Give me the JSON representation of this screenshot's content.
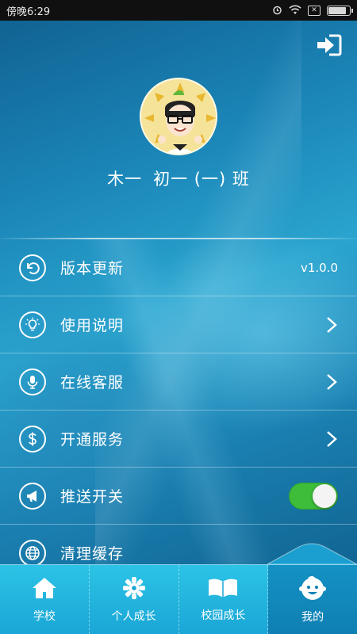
{
  "status_bar": {
    "time": "傍晚6:29",
    "battery_level": 0.9
  },
  "header": {
    "logout_icon": "logout-icon"
  },
  "profile": {
    "name": "木一",
    "class": "初一 (一) 班"
  },
  "menu": [
    {
      "label": "版本更新",
      "icon": "refresh-icon",
      "value": "v1.0.0"
    },
    {
      "label": "使用说明",
      "icon": "lightbulb-icon"
    },
    {
      "label": "在线客服",
      "icon": "microphone-icon"
    },
    {
      "label": "开通服务",
      "icon": "dollar-icon"
    },
    {
      "label": "推送开关",
      "icon": "megaphone-icon",
      "toggle_on": true
    },
    {
      "label": "清理缓存",
      "icon": "globe-icon"
    }
  ],
  "tabs": [
    {
      "label": "学校",
      "icon": "home-icon"
    },
    {
      "label": "个人成长",
      "icon": "gear-flower-icon"
    },
    {
      "label": "校园成长",
      "icon": "open-book-icon"
    },
    {
      "label": "我的",
      "icon": "baby-face-icon",
      "active": true
    }
  ],
  "colors": {
    "toggle_on": "#3dbd3a",
    "tab_bar": "#1aa6d6",
    "tab_active": "#0f7fb2"
  }
}
